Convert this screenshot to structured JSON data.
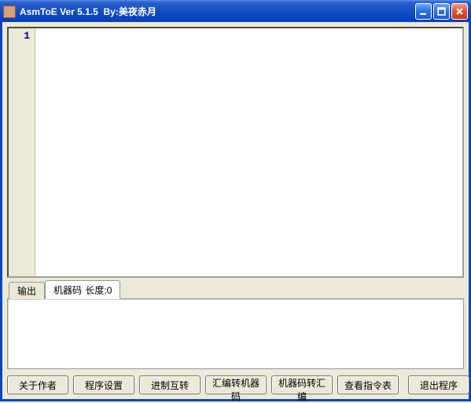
{
  "window": {
    "title": "AsmToE Ver 5.1.5  By:美夜赤月"
  },
  "editor": {
    "line_number": "1",
    "content": ""
  },
  "tabs": {
    "output_label": "输出",
    "machinecode_label": "机器码",
    "length_label": "长度:",
    "length_value": "0"
  },
  "output": {
    "content": ""
  },
  "buttons": {
    "about": "关于作者",
    "settings": "程序设置",
    "radix": "进制互转",
    "asm_to_mc": "汇编转机器码",
    "mc_to_asm": "机器码转汇编",
    "opcode_table": "查看指令表",
    "exit": "退出程序"
  }
}
